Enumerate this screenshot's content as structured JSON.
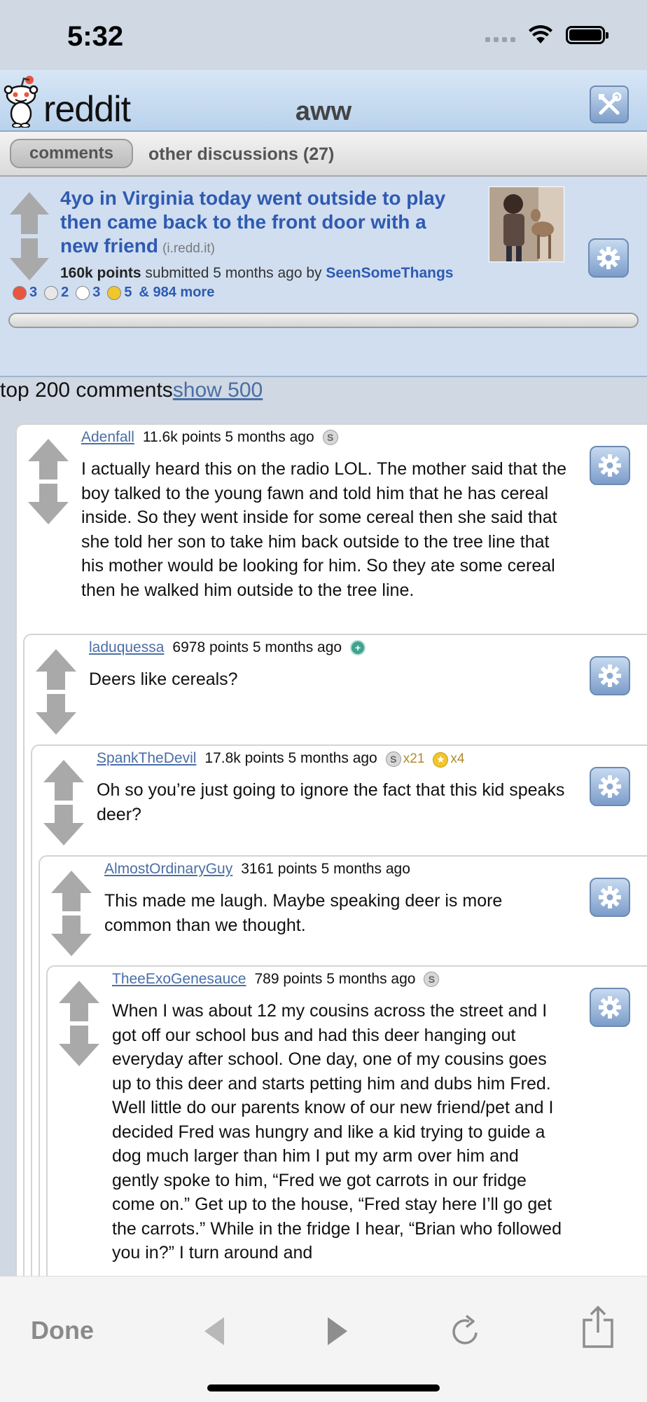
{
  "status_bar": {
    "time": "5:32"
  },
  "header": {
    "logo_text": "reddit",
    "subreddit": "aww"
  },
  "tabs": {
    "comments": "comments",
    "other": "other discussions (27)"
  },
  "post": {
    "title": "4yo in Virginia today went outside to play then came back to the front door with a new friend",
    "domain": "(i.redd.it)",
    "points": "160k points",
    "submitted": "submitted 5 months ago",
    "by_label": "by",
    "author": "SeenSomeThangs",
    "awards": [
      {
        "icon": "award-icon-1",
        "count": "3",
        "color": "#e8563f"
      },
      {
        "icon": "award-icon-2",
        "count": "2",
        "color": "#e8e8e8"
      },
      {
        "icon": "award-icon-3",
        "count": "3",
        "color": "#ffffff"
      },
      {
        "icon": "award-icon-4",
        "count": "5",
        "color": "#f1c62b"
      }
    ],
    "awards_more": "& 984 more",
    "progress_fraction": 0
  },
  "comments_header": {
    "label": "top 200 comments",
    "show_link": "show 500"
  },
  "comments": [
    {
      "author": "Adenfall",
      "meta": "11.6k points 5 months ago",
      "body": "I actually heard this on the radio LOL. The mother said that the boy talked to the young fawn and told him that he has cereal inside. So they went inside for some cereal then she said that she told her son to take him back outside to the tree line that his mother would be looking for him. So they ate some cereal then he walked him outside to the tree line."
    },
    {
      "author": "laduquessa",
      "meta": "6978 points 5 months ago",
      "body": "Deers like cereals?"
    },
    {
      "author": "SpankTheDevil",
      "meta": "17.8k points 5 months ago",
      "silver_count": "x21",
      "gold_count": "x4",
      "body": "Oh so you’re just going to ignore the fact that this kid speaks deer?"
    },
    {
      "author": "AlmostOrdinaryGuy",
      "meta": "3161 points 5 months ago",
      "body": "This made me laugh. Maybe speaking deer is more common than we thought."
    },
    {
      "author": "TheeExoGenesauce",
      "meta": "789 points 5 months ago",
      "body": "When I was about 12 my cousins across the street and I got off our school bus and had this deer hanging out everyday after school. One day, one of my cousins goes up to this deer and starts petting him and dubs him Fred. Well little do our parents know of our new friend/pet and I decided Fred was hungry and like a kid trying to guide a dog much larger than him I put my arm over him and gently spoke to him, “Fred we got carrots in our fridge come on.” Get up to the house, “Fred stay here I’ll go get the carrots.” While in the fridge I hear, “Brian who followed you in?” I turn around and"
    }
  ],
  "bottom_bar": {
    "done": "Done"
  }
}
